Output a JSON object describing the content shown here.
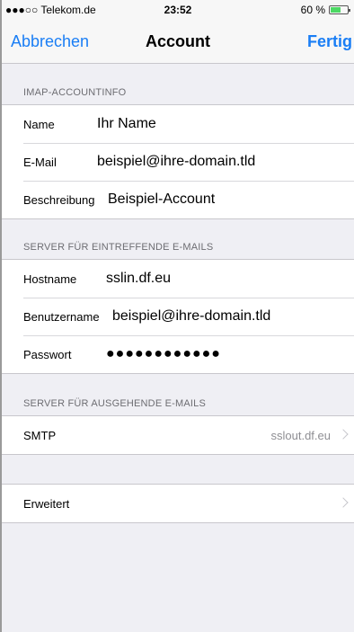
{
  "statusbar": {
    "carrier": "●●●○○ Telekom.de",
    "time": "23:52",
    "battery": "60 %",
    "battery_level": 0.6
  },
  "nav": {
    "cancel": "Abbrechen",
    "title": "Account",
    "done": "Fertig"
  },
  "sections": {
    "imap_header": "IMAP-ACCOUNTINFO",
    "incoming_header": "SERVER FÜR EINTREFFENDE E-MAILS",
    "outgoing_header": "SERVER FÜR AUSGEHENDE E-MAILS"
  },
  "account": {
    "name_label": "Name",
    "name_value": "Ihr Name",
    "email_label": "E-Mail",
    "email_value": "beispiel@ihre-domain.tld",
    "desc_label": "Beschreibung",
    "desc_value": "Beispiel-Account"
  },
  "incoming": {
    "host_label": "Hostname",
    "host_value": "sslin.df.eu",
    "user_label": "Benutzername",
    "user_value": "beispiel@ihre-domain.tld",
    "pass_label": "Passwort",
    "pass_value": "●●●●●●●●●●●●"
  },
  "outgoing": {
    "smtp_label": "SMTP",
    "smtp_value": "sslout.df.eu"
  },
  "advanced": {
    "label": "Erweitert"
  }
}
